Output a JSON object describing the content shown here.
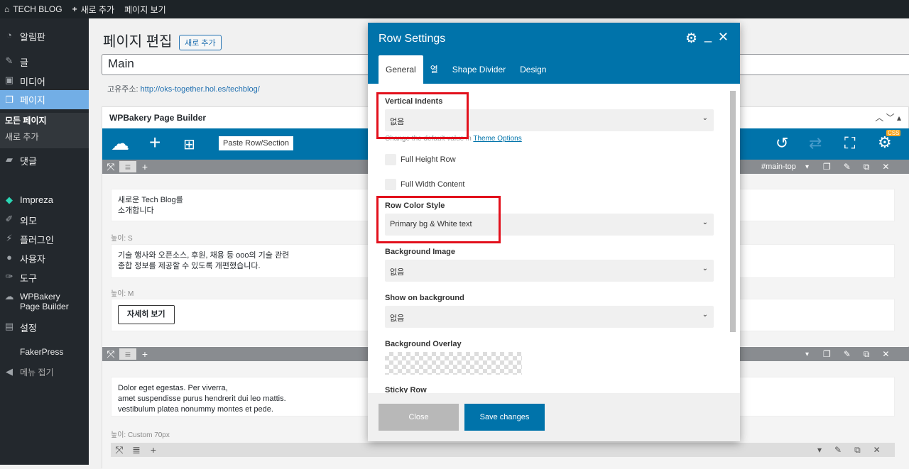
{
  "topbar": {
    "site": "TECH BLOG",
    "new": "새로 추가",
    "view": "페이지 보기"
  },
  "sidebar": {
    "items": [
      "알림판",
      "글",
      "미디어",
      "페이지",
      "댓글",
      "Impreza",
      "외모",
      "플러그인",
      "사용자",
      "도구",
      "WPBakery Page Builder",
      "설정",
      "FakerPress",
      "메뉴 접기"
    ],
    "sub": [
      "모든 페이지",
      "새로 추가"
    ]
  },
  "page": {
    "title": "페이지 편집",
    "add_new": "새로 추가",
    "post_title": "Main",
    "permalink_label": "고유주소:",
    "permalink": "http://oks-together.hol.es/techblog/"
  },
  "wpb": {
    "title": "WPBakery Page Builder",
    "paste": "Paste Row/Section",
    "row_id": "#main-top",
    "css_badge": "CSS",
    "texts": [
      "새로운 Tech Blog를",
      "소개합니다",
      "기술 행사와 오픈소스, 후원, 채용 등 ooo의 기술 관련",
      "종합 정보를 제공할 수 있도록 개편했습니다.",
      "자세히 보기",
      "Dolor eget egestas. Per viverra,",
      "amet suspendisse purus hendrerit dui leo mattis.",
      "vestibulum platea nonummy montes et pede."
    ],
    "spacers": [
      "높이: S",
      "높이: M",
      "높이: Custom  70px"
    ]
  },
  "modal": {
    "title": "Row Settings",
    "tabs": [
      "General",
      "열",
      "Shape Divider",
      "Design"
    ],
    "vertical_indents": {
      "label": "Vertical Indents",
      "value": "없음",
      "hint": "Change the default value in",
      "hint_link": "Theme Options"
    },
    "full_height": "Full Height Row",
    "full_width": "Full Width Content",
    "row_color": {
      "label": "Row Color Style",
      "value": "Primary bg & White text"
    },
    "bg_image": {
      "label": "Background Image",
      "value": "없음"
    },
    "show_on_bg": {
      "label": "Show on background",
      "value": "없음"
    },
    "overlay": {
      "label": "Background Overlay"
    },
    "sticky": {
      "label": "Sticky Row"
    },
    "close": "Close",
    "save": "Save changes"
  },
  "colors": {
    "accent": "#0073aa",
    "highlight": "#e2101c"
  }
}
